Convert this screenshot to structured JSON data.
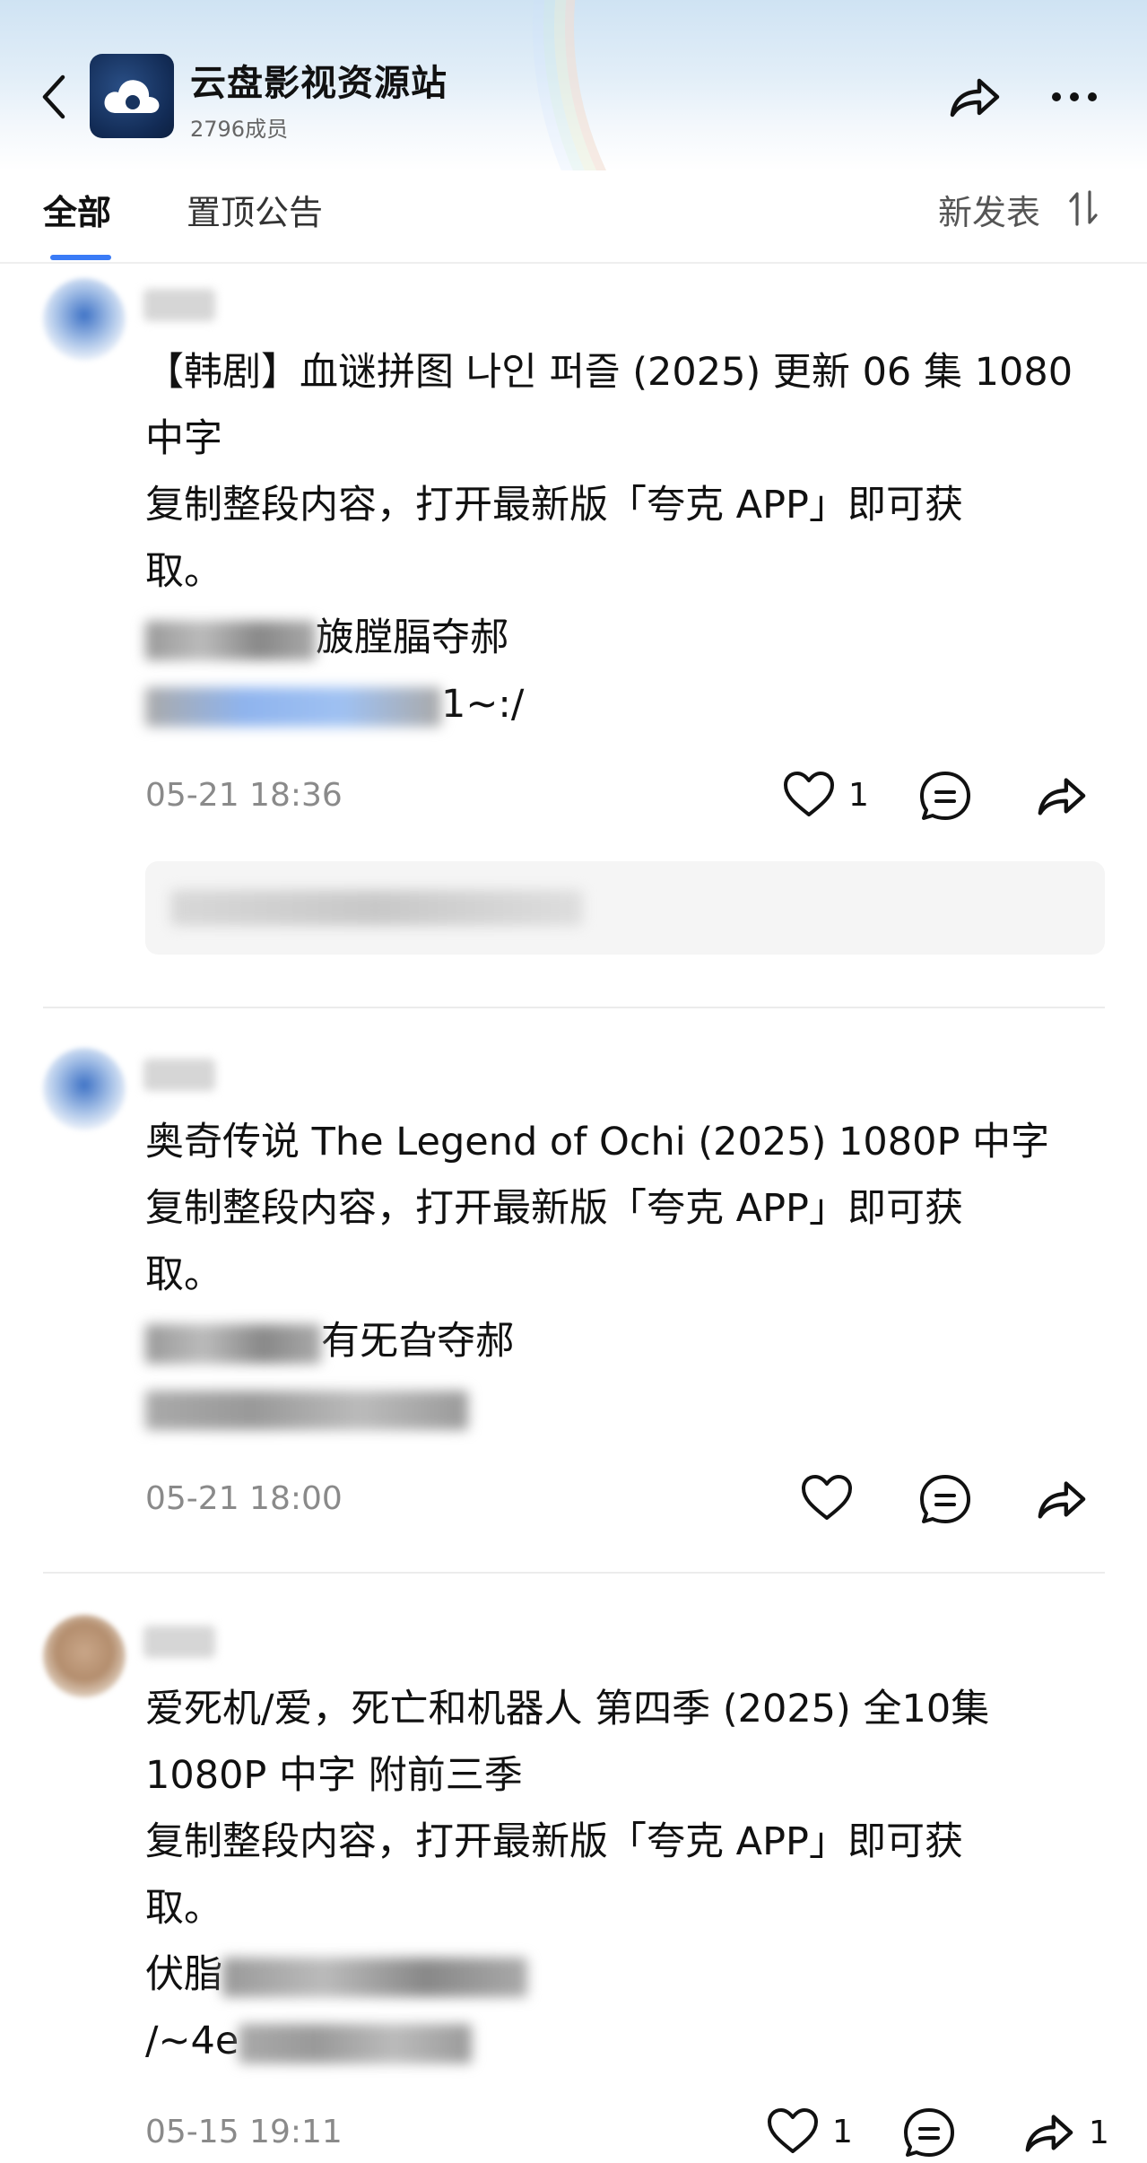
{
  "header": {
    "group_name": "云盘影视资源站",
    "member_count": "2796成员"
  },
  "tabs": [
    {
      "label": "全部",
      "active": true
    },
    {
      "label": "置顶公告",
      "active": false
    }
  ],
  "sort": {
    "label": "新发表"
  },
  "colors": {
    "accent": "#3a7bf6",
    "timestamp": "#8a8a8a",
    "comment_bg": "#f5f5f5"
  },
  "posts": [
    {
      "title_lines": [
        "【韩剧】血谜拼图 나인 퍼즐 (2025) 更新 06 集 1080",
        "中字"
      ],
      "body_lines": [
        "复制整段内容，打开最新版「夸克 APP」即可获",
        "取。"
      ],
      "code_tail": "旇膛腷夺郝",
      "link_tail": "1~:/",
      "timestamp": "05-21 18:36",
      "like_count": "1",
      "share_count": "",
      "has_comment_preview": true
    },
    {
      "title_lines": [
        "奥奇传说 The Legend of Ochi (2025) 1080P 中字"
      ],
      "body_lines": [
        "复制整段内容，打开最新版「夸克 APP」即可获",
        "取。"
      ],
      "code_tail": "有旡旮夺郝",
      "link_tail": "",
      "timestamp": "05-21 18:00",
      "like_count": "",
      "share_count": "",
      "has_comment_preview": false
    },
    {
      "title_lines": [
        "爱死机/爱，死亡和机器人 第四季 (2025) 全10集",
        "1080P 中字  附前三季"
      ],
      "body_lines": [
        "复制整段内容，打开最新版「夸克 APP」即可获",
        "取。"
      ],
      "code_head": "伏脂",
      "link_head": "/~4e",
      "timestamp": "05-15 19:11",
      "like_count": "1",
      "share_count": "1",
      "has_comment_preview": false
    }
  ]
}
